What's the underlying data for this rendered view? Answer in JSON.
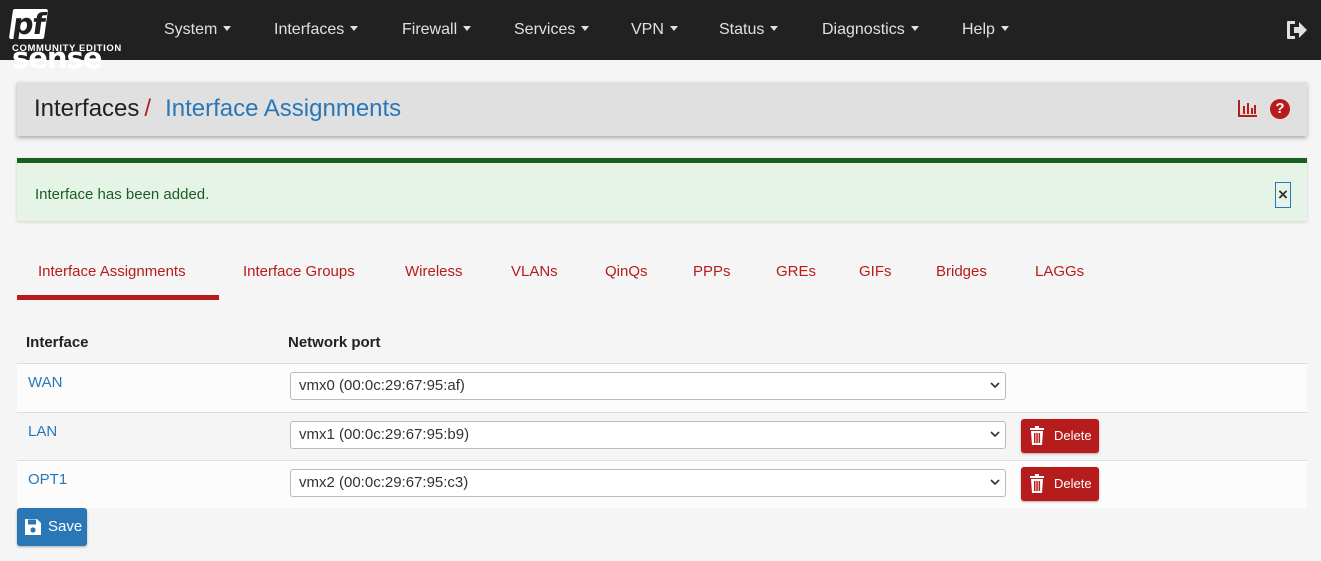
{
  "logo": {
    "brand": "pfsense",
    "edition": "COMMUNITY EDITION"
  },
  "nav": {
    "items": [
      {
        "label": "System"
      },
      {
        "label": "Interfaces"
      },
      {
        "label": "Firewall"
      },
      {
        "label": "Services"
      },
      {
        "label": "VPN"
      },
      {
        "label": "Status"
      },
      {
        "label": "Diagnostics"
      },
      {
        "label": "Help"
      }
    ]
  },
  "breadcrumb": {
    "root": "Interfaces",
    "separator": "/",
    "page": "Interface Assignments"
  },
  "alert": {
    "message": "Interface has been added.",
    "close": "×"
  },
  "tabs": [
    {
      "label": "Interface Assignments",
      "active": true
    },
    {
      "label": "Interface Groups"
    },
    {
      "label": "Wireless"
    },
    {
      "label": "VLANs"
    },
    {
      "label": "QinQs"
    },
    {
      "label": "PPPs"
    },
    {
      "label": "GREs"
    },
    {
      "label": "GIFs"
    },
    {
      "label": "Bridges"
    },
    {
      "label": "LAGGs"
    }
  ],
  "table": {
    "headers": {
      "interface": "Interface",
      "network_port": "Network port"
    },
    "rows": [
      {
        "interface": "WAN",
        "port": "vmx0 (00:0c:29:67:95:af)"
      },
      {
        "interface": "LAN",
        "port": "vmx1 (00:0c:29:67:95:b9)",
        "action": "Delete"
      },
      {
        "interface": "OPT1",
        "port": "vmx2 (00:0c:29:67:95:c3)",
        "action": "Delete"
      }
    ]
  },
  "save_label": "Save",
  "colors": {
    "navbar": "#212121",
    "accent_red": "#b71c1c",
    "link_blue": "#2a77b7",
    "success_green": "#1b5e20"
  }
}
